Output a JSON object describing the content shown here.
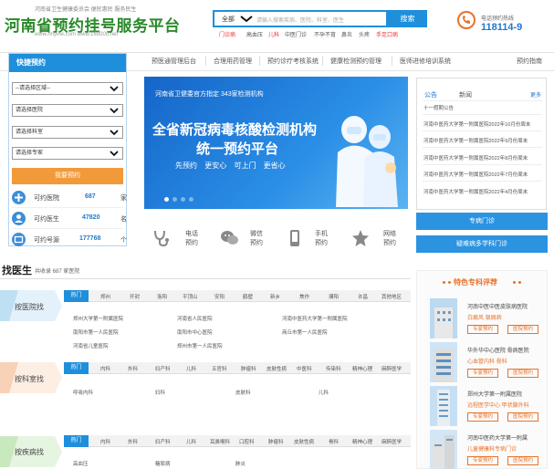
{
  "header": {
    "tagline": "河南省卫生健康委员会   便民惠民   服务民生",
    "title": "河南省预约挂号服务平台",
    "url": "www.hnyihe.com   www.160000.net",
    "search": {
      "category": "全部",
      "placeholder": "请输入搜索疾病、医院、科室、医生",
      "button": "搜索"
    },
    "hot_words": [
      "门诊病",
      "高血压",
      "儿科",
      "中医门诊",
      "不孕不育",
      "鼻炎",
      "头疼",
      "手足口病"
    ],
    "phone_label": "电话预约热线",
    "phone_number": "118114-9"
  },
  "nav": [
    "预医通管理后台",
    "合理用药管理",
    "预约诊疗考核系统",
    "健康检测预约管理",
    "医师进修培训系统",
    "预约指南"
  ],
  "quick_booking": {
    "title": "快捷预约",
    "selects": [
      "--请选择区域--",
      "请选择医院",
      "请选择科室",
      "请选择专家"
    ],
    "button": "我要预约",
    "stats": [
      {
        "label": "可约医院",
        "value": "687",
        "unit": "家"
      },
      {
        "label": "可约医生",
        "value": "47820",
        "unit": "名"
      },
      {
        "label": "可约号源",
        "value": "177768",
        "unit": "个"
      }
    ]
  },
  "banner": {
    "subtitle": "河南省卫健委官方指定   343家检测机构",
    "line1": "全省新冠病毒核酸检测机构",
    "line2": "统一预约平台",
    "line3": "先预约  更安心  可上门  更省心"
  },
  "features": [
    {
      "icon": "stethoscope-icon",
      "label1": "电话",
      "label2": "预约"
    },
    {
      "icon": "wechat-icon",
      "label1": "微信",
      "label2": "预约"
    },
    {
      "icon": "mobile-icon",
      "label1": "手机",
      "label2": "预约"
    },
    {
      "icon": "web-icon",
      "label1": "网络",
      "label2": "预约"
    }
  ],
  "notices": {
    "tabs": [
      "公告",
      "新闻"
    ],
    "more": "更多",
    "items": [
      "十一假期公告",
      "河南中医药大学第一附属医院2022年10月份周末",
      "河南中医药大学第一附属医院2022年9月份周末",
      "河南中医药大学第一附属医院2022年8月份周末",
      "河南中医药大学第一附属医院2022年7月份周末",
      "河南中医药大学第一附属医院2022年4月份周末"
    ]
  },
  "side_buttons": [
    "专病门诊",
    "疑难病多学科门诊"
  ],
  "find_doctor": {
    "title": "找医生",
    "subtitle": "共收录 687 家医院",
    "sections": [
      {
        "label": "按医院找",
        "tabs": [
          "热门",
          "郑州",
          "开封",
          "洛阳",
          "平顶山",
          "安阳",
          "鹤壁",
          "新乡",
          "焦作",
          "濮阳",
          "许昌",
          "其他地区"
        ],
        "hospitals": [
          "郑州大学第一附属医院",
          "河南省人民医院",
          "河南中医药大学第一附属医院",
          "南阳市第一人民医院",
          "南阳市中心医院",
          "商丘市第一人民医院",
          "河南省儿童医院",
          "郑州市第一人民医院"
        ]
      },
      {
        "label": "按科室找",
        "tabs": [
          "热门",
          "内科",
          "外科",
          "妇产科",
          "儿科",
          "五官科",
          "肿瘤科",
          "皮肤性病",
          "中医科",
          "传染科",
          "精神心理",
          "麻醉医学"
        ],
        "hospitals": [
          "呼吸内科",
          "妇科",
          "皮肤科",
          "儿科"
        ]
      },
      {
        "label": "按疾病找",
        "tabs": [
          "热门",
          "内科",
          "外科",
          "妇产科",
          "儿科",
          "耳鼻喉科",
          "口腔科",
          "肿瘤科",
          "皮肤性病",
          "骨科",
          "精神心理",
          "麻醉医学"
        ],
        "hospitals": [
          "高血压",
          "糖尿病",
          "肺炎"
        ]
      }
    ]
  },
  "special": {
    "title": "特色专科评荐",
    "items": [
      {
        "name": "河南中医中医皮肤病医院",
        "tags": "白癜风  银屑病"
      },
      {
        "name": "华外华中心医院 骨病医院",
        "tags": "心血管内科  骨科"
      },
      {
        "name": "郑州大学第一附属医院",
        "tags": "远程医学中心  甲状腺外科"
      },
      {
        "name": "河南中医药大学第一附属",
        "tags": "儿童健康科专病门诊"
      }
    ],
    "btn1": "专家预约",
    "btn2": "医院预约"
  }
}
